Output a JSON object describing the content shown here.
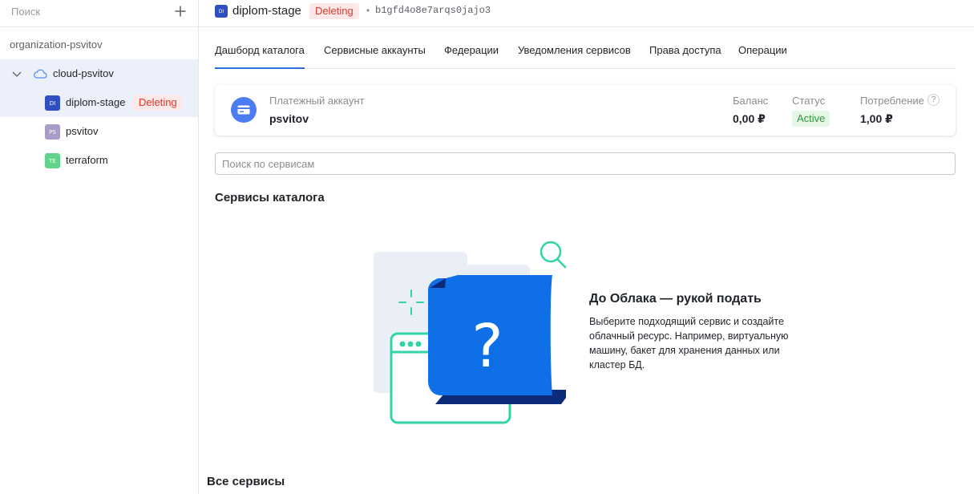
{
  "sidebar": {
    "search_placeholder": "Поиск",
    "organization": "organization-psvitov",
    "cloud": {
      "label": "cloud-psvitov"
    },
    "folders": [
      {
        "initials": "DI",
        "label": "diplom-stage",
        "badge": "Deleting",
        "color": "#2f4fc3"
      },
      {
        "initials": "PS",
        "label": "psvitov",
        "badge": "",
        "color": "#a99cc9"
      },
      {
        "initials": "TE",
        "label": "terraform",
        "badge": "",
        "color": "#5fd48a"
      }
    ]
  },
  "header": {
    "initials": "DI",
    "title": "diplom-stage",
    "badge": "Deleting",
    "separator": "•",
    "folder_id": "b1gfd4o8e7arqs0jajo3"
  },
  "tabs": [
    {
      "label": "Дашборд каталога",
      "active": true
    },
    {
      "label": "Сервисные аккаунты",
      "active": false
    },
    {
      "label": "Федерации",
      "active": false
    },
    {
      "label": "Уведомления сервисов",
      "active": false
    },
    {
      "label": "Права доступа",
      "active": false
    },
    {
      "label": "Операции",
      "active": false
    }
  ],
  "billing": {
    "account_label": "Платежный аккаунт",
    "account_value": "psvitov",
    "balance_label": "Баланс",
    "balance_value": "0,00 ₽",
    "status_label": "Статус",
    "status_value": "Active",
    "consumption_label": "Потребление",
    "consumption_value": "1,00 ₽",
    "help": "?"
  },
  "services": {
    "search_placeholder": "Поиск по сервисам",
    "section_title": "Сервисы каталога",
    "empty_title": "До Облака — рукой подать",
    "empty_text": "Выберите подходящий сервис и создайте облачный ресурс. Например, виртуальную машину, бакет для хранения данных или кластер БД.",
    "all_title": "Все сервисы"
  },
  "colors": {
    "accent": "#2a6fdb",
    "deleting_text": "#e0352b",
    "deleting_bg": "#fde8e8",
    "active_text": "#2e9a3a",
    "active_bg": "#e6f6e6",
    "selected_row": "#ebf0fa",
    "illustration_blue": "#0f6fe6",
    "illustration_teal": "#2fd4a7"
  },
  "icons": [
    "plus-icon",
    "chevron-down-icon",
    "cloud-icon",
    "credit-card-icon",
    "help-icon",
    "magnifier-icon"
  ]
}
